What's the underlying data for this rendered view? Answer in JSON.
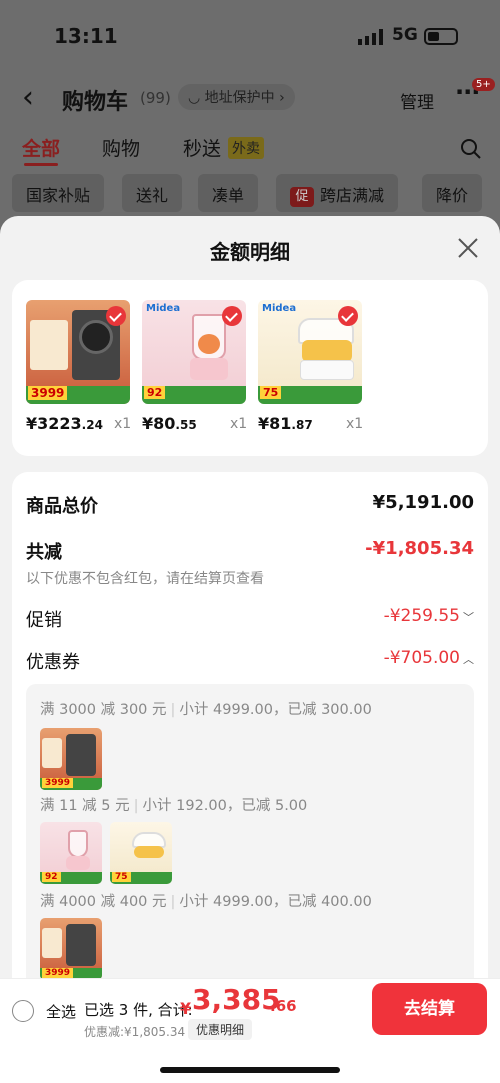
{
  "status": {
    "time": "13:11",
    "network": "5G"
  },
  "nav": {
    "back_icon": "‹",
    "title": "购物车",
    "count": "(99)",
    "address_label": "◡ 地址保护中 ›",
    "manage": "管理",
    "more_icon": "···",
    "badge": "5+"
  },
  "tabs": {
    "all": "全部",
    "shop": "购物",
    "flash": "秒送",
    "flash_tag": "外卖"
  },
  "chips": [
    "国家补贴",
    "送礼",
    "凑单",
    "跨店满减",
    "降价"
  ],
  "chip_icon_text": "促",
  "sheet": {
    "title": "金额明细",
    "products": [
      {
        "price_int": "¥3223",
        "price_dec": ".24",
        "qty": "x1",
        "img_price": "3999",
        "icon": "washer-dryer-image"
      },
      {
        "price_int": "¥80",
        "price_dec": ".55",
        "qty": "x1",
        "img_price": "92",
        "brand": "Midea",
        "icon": "blender-image"
      },
      {
        "price_int": "¥81",
        "price_dec": ".87",
        "qty": "x1",
        "img_price": "75",
        "brand": "Midea",
        "icon": "egg-cooker-image"
      }
    ],
    "total_label": "商品总价",
    "total_value": "¥5,191.00",
    "reduce_label": "共减",
    "reduce_value": "-¥1,805.34",
    "reduce_hint": "以下优惠不包含红包，请在结算页查看",
    "promo_label": "促销",
    "promo_value": "-¥259.55",
    "coupon_label": "优惠券",
    "coupon_value": "-¥705.00",
    "coupons": [
      {
        "rule": "满 3000 减 300 元",
        "subtotal": "小计 4999.00，已减 300.00"
      },
      {
        "rule": "满 11 减 5 元",
        "subtotal": "小计 192.00，已减 5.00"
      },
      {
        "rule": "满 4000 减 400 元",
        "subtotal": "小计 4999.00，已减 400.00"
      }
    ]
  },
  "checkout": {
    "select_all": "全选",
    "selected": "已选 3 件, 合计:",
    "currency": "¥",
    "total_int": "3,385",
    "total_dec": ".66",
    "discount": "优惠减:¥1,805.34",
    "detail": "优惠明细",
    "button": "去结算"
  },
  "colors": {
    "accent": "#e8363a",
    "dim_bg": "#6d6d6d"
  }
}
